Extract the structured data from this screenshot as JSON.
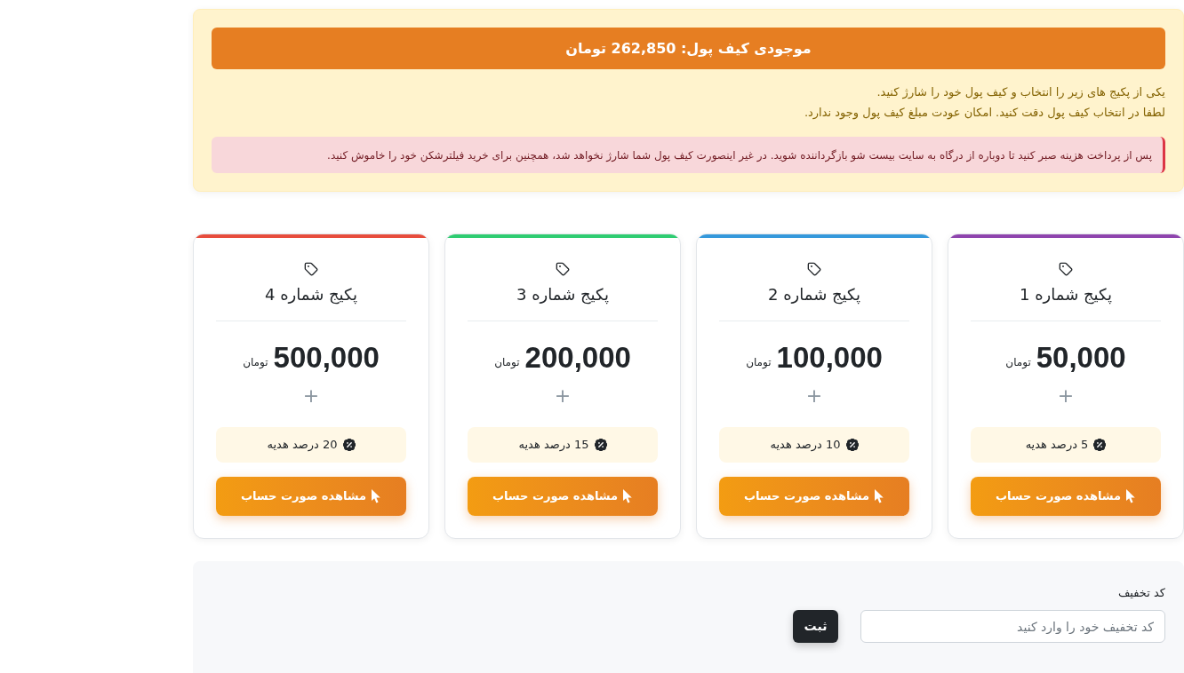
{
  "wallet": {
    "balance_title": "موجودی کیف پول: 262,850 تومان",
    "instructions": [
      "یکی از پکیج های زیر را انتخاب و کیف پول خود را شارژ کنید.",
      "لطفا در انتخاب کیف پول دقت کنید. امکان عودت مبلغ کیف پول وجود ندارد."
    ],
    "warning": "پس از پرداخت هزینه صبر کنید تا دوباره از درگاه به سایت بیست شو بازگرداننده شوید. در غیر اینصورت کیف پول شما شارژ نخواهد شد، همچنین برای خرید فیلترشکن خود را خاموش کنید."
  },
  "packages": [
    {
      "title": "پکیج شماره 1",
      "color": "#8e44ad",
      "price": "50,000",
      "currency": "تومان",
      "plus": "+",
      "gift": "5 درصد هدیه",
      "button": "مشاهده صورت حساب"
    },
    {
      "title": "پکیج شماره 2",
      "color": "#3498db",
      "price": "100,000",
      "currency": "تومان",
      "plus": "+",
      "gift": "10 درصد هدیه",
      "button": "مشاهده صورت حساب"
    },
    {
      "title": "پکیج شماره 3",
      "color": "#2ecc71",
      "price": "200,000",
      "currency": "تومان",
      "plus": "+",
      "gift": "15 درصد هدیه",
      "button": "مشاهده صورت حساب"
    },
    {
      "title": "پکیج شماره 4",
      "color": "#e74c3c",
      "price": "500,000",
      "currency": "تومان",
      "plus": "+",
      "gift": "20 درصد هدیه",
      "button": "مشاهده صورت حساب"
    }
  ],
  "discount": {
    "label": "کد تخفیف",
    "placeholder": "کد تخفیف خود را وارد کنید",
    "button": "ثبت"
  }
}
